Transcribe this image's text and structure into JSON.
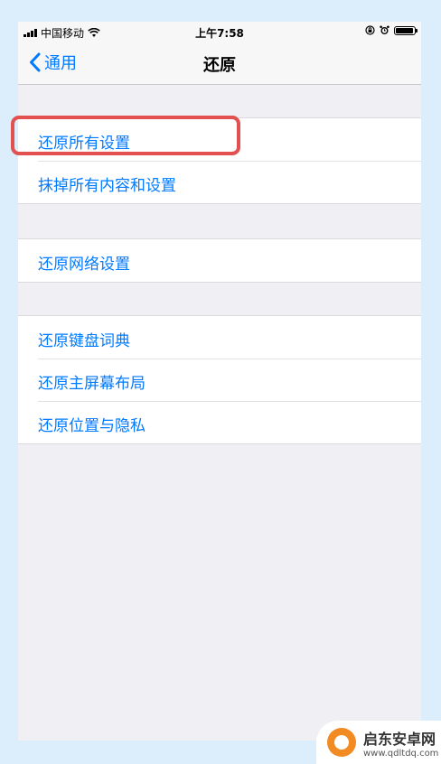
{
  "status_bar": {
    "carrier": "中国移动",
    "time": "上午7:58"
  },
  "nav": {
    "back_label": "通用",
    "title": "还原"
  },
  "groups": [
    {
      "items": [
        "还原所有设置",
        "抹掉所有内容和设置"
      ]
    },
    {
      "items": [
        "还原网络设置"
      ]
    },
    {
      "items": [
        "还原键盘词典",
        "还原主屏幕布局",
        "还原位置与隐私"
      ]
    }
  ],
  "highlight_color": "#e2504f",
  "accent_color": "#007aff",
  "watermark": {
    "name": "启东安卓网",
    "url": "www.qdltdq.com"
  }
}
